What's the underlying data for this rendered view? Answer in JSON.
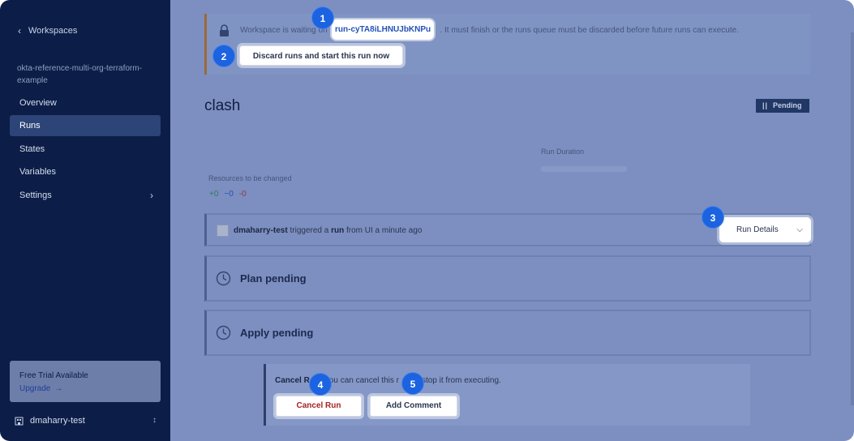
{
  "sidebar": {
    "back_label": "Workspaces",
    "workspace_name": "okta-reference-multi-org-terraform-example",
    "items": [
      {
        "label": "Overview"
      },
      {
        "label": "Runs"
      },
      {
        "label": "States"
      },
      {
        "label": "Variables"
      },
      {
        "label": "Settings"
      }
    ],
    "trial": {
      "title": "Free Trial Available",
      "link": "Upgrade"
    },
    "user": "dmaharry-test"
  },
  "banner": {
    "message": "Workspace is waiting on",
    "run_id": "run-cyTA8iLHNUJbKNPu",
    "message_tail": ". It must finish or the runs queue must be discarded before future runs can execute.",
    "discard_label": "Discard runs and start this run now"
  },
  "run": {
    "title": "clash",
    "status": "Pending",
    "duration_label": "Run Duration",
    "resources_label": "Resources to be changed",
    "resources": {
      "add": "+0",
      "change": "~0",
      "destroy": "-0"
    },
    "trigger": {
      "user": "dmaharry-test",
      "text1": "triggered a",
      "run_word": "run",
      "text2": "from UI a minute ago"
    },
    "details_label": "Run Details",
    "plan_label": "Plan pending",
    "apply_label": "Apply pending",
    "cancel_title": "Cancel R",
    "cancel_text": "ou can cancel this r",
    "cancel_text2": "stop it from executing.",
    "cancel_button": "Cancel Run",
    "comment_button": "Add Comment"
  },
  "markers": [
    "1",
    "2",
    "3",
    "4",
    "5"
  ],
  "colors": {
    "sidebar_bg": "#0c1e47",
    "main_bg": "#7c8fc0",
    "marker": "#1b63e0",
    "cancel_text": "#a52222"
  }
}
